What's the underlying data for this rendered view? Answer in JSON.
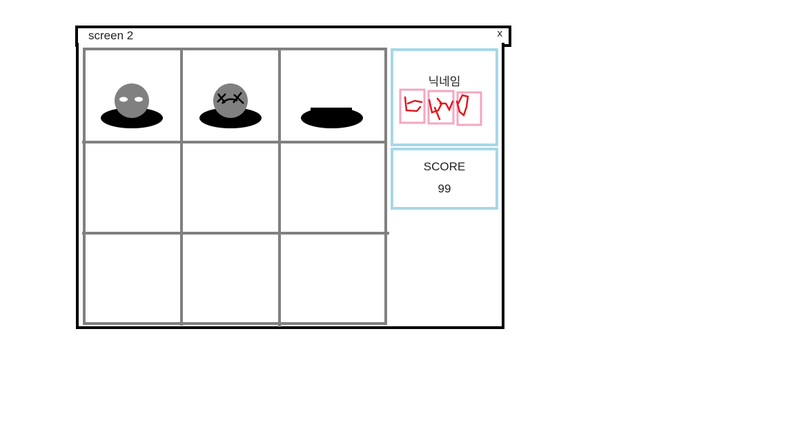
{
  "window": {
    "title": "screen 2",
    "close_label": "x"
  },
  "board": {
    "rows": 3,
    "cols": 3,
    "cells": [
      {
        "content": "mole-idle"
      },
      {
        "content": "mole-hit"
      },
      {
        "content": "empty-hole"
      },
      {
        "content": ""
      },
      {
        "content": ""
      },
      {
        "content": ""
      },
      {
        "content": ""
      },
      {
        "content": ""
      },
      {
        "content": ""
      }
    ]
  },
  "nickname": {
    "label": "닉네임"
  },
  "score": {
    "label": "SCORE",
    "value": "99"
  },
  "colors": {
    "grid": "#808080",
    "mole": "#808080",
    "hole": "#000000",
    "panel_border": "#a6d8e8",
    "nickname_box": "#f4a6c2",
    "scribble": "#e0191e"
  }
}
